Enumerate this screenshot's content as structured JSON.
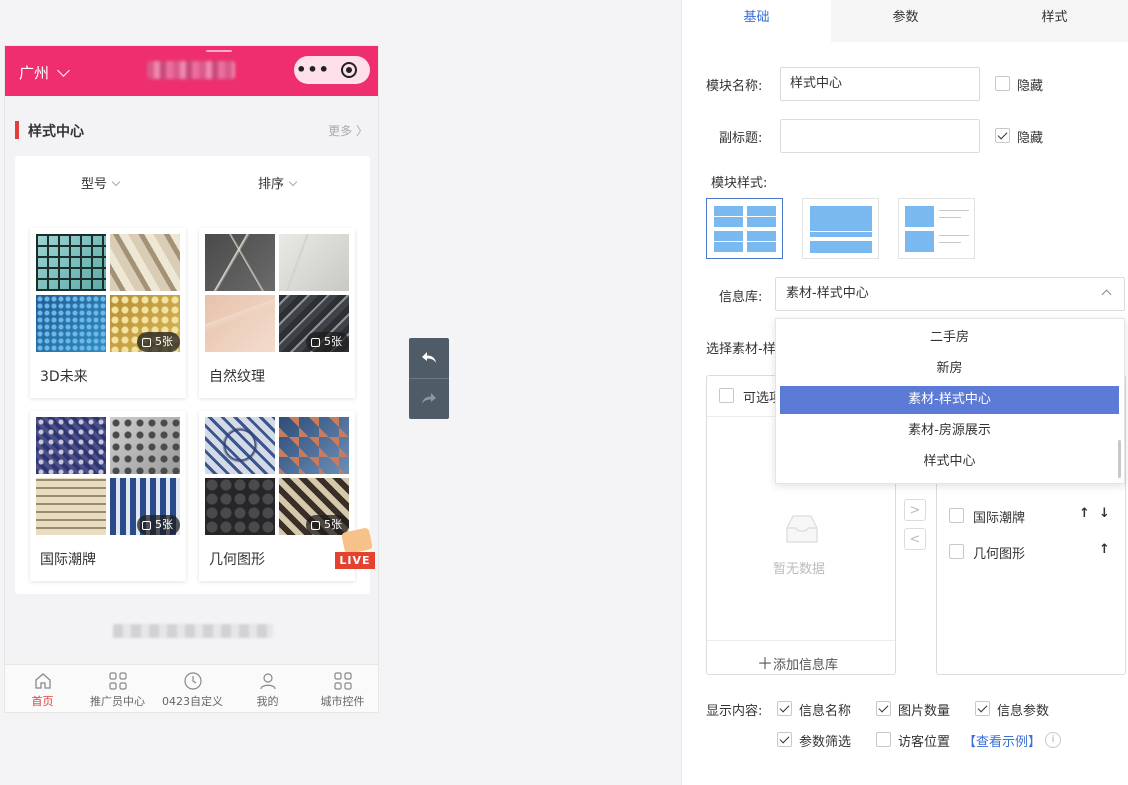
{
  "phone": {
    "city": "广州",
    "section_title": "样式中心",
    "section_more": "更多 〉",
    "filters": [
      "型号",
      "排序"
    ],
    "tiles": [
      {
        "name": "3D未来",
        "count": "5张"
      },
      {
        "name": "自然纹理",
        "count": "5张"
      },
      {
        "name": "国际潮牌",
        "count": "5张"
      },
      {
        "name": "几何图形",
        "count": "5张"
      }
    ],
    "live_badge": "LIVE",
    "tabbar": [
      "首页",
      "推广员中心",
      "0423自定义",
      "我的",
      "城市控件"
    ],
    "accent_color": "#ee2e6e"
  },
  "panel": {
    "tabs": [
      "基础",
      "参数",
      "样式"
    ],
    "module_name_label": "模块名称:",
    "module_name_value": "样式中心",
    "hide_label": "隐藏",
    "subtitle_label": "副标题:",
    "subtitle_value": "",
    "module_style_label": "模块样式:",
    "info_lib_label": "信息库:",
    "info_lib_value": "素材-样式中心",
    "select_material_label": "选择素材-样",
    "transfer_left_header": "可选项",
    "transfer_empty": "暂无数据",
    "add_info_lib": "添加信息库",
    "transfer_right_items": [
      {
        "label": "国际潮牌"
      },
      {
        "label": "几何图形"
      }
    ],
    "dropdown_options": [
      "二手房",
      "新房",
      "素材-样式中心",
      "素材-房源展示",
      "样式中心"
    ],
    "display_label": "显示内容:",
    "display_options": [
      {
        "label": "信息名称",
        "checked": true
      },
      {
        "label": "图片数量",
        "checked": true
      },
      {
        "label": "信息参数",
        "checked": true
      },
      {
        "label": "参数筛选",
        "checked": true
      },
      {
        "label": "访客位置",
        "checked": false
      }
    ],
    "view_example": "【查看示例】",
    "info_icon": "i",
    "accent_color": "#3a6fd8"
  }
}
